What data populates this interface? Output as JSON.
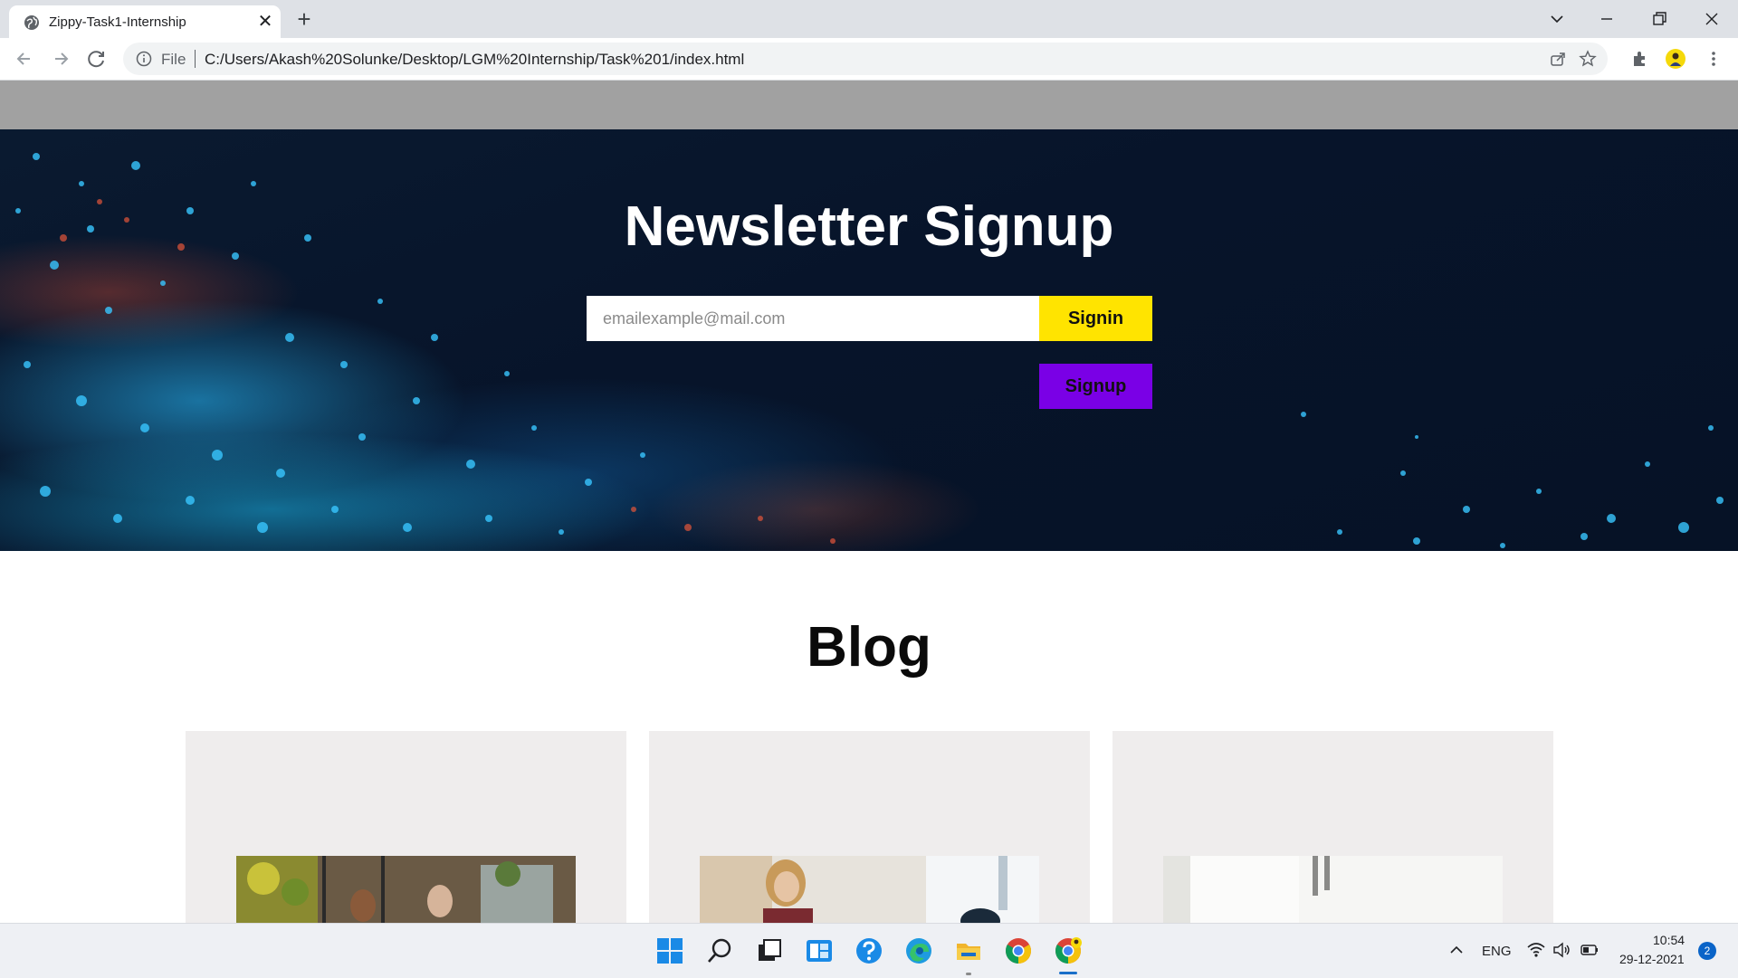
{
  "browser": {
    "tab_title": "Zippy-Task1-Internship",
    "tab_close": "✕",
    "new_tab": "+",
    "file_label": "File",
    "url": "C:/Users/Akash%20Solunke/Desktop/LGM%20Internship/Task%201/index.html"
  },
  "hero": {
    "title": "Newsletter Signup",
    "email_placeholder": "emailexample@mail.com",
    "signin_label": "Signin",
    "signup_label": "Signup",
    "signin_color": "#ffe400",
    "signup_color": "#7a00e6"
  },
  "blog": {
    "title": "Blog",
    "cards": [
      {
        "image": "office-team-photo"
      },
      {
        "image": "woman-meeting-photo"
      },
      {
        "image": "bright-room-photo"
      }
    ]
  },
  "taskbar": {
    "language": "ENG",
    "time": "10:54",
    "date": "29-12-2021",
    "notification_count": "2"
  },
  "colors": {
    "page_topbar": "#a1a1a1",
    "card_bg": "#efeded",
    "hero_bg": "#07142a"
  }
}
